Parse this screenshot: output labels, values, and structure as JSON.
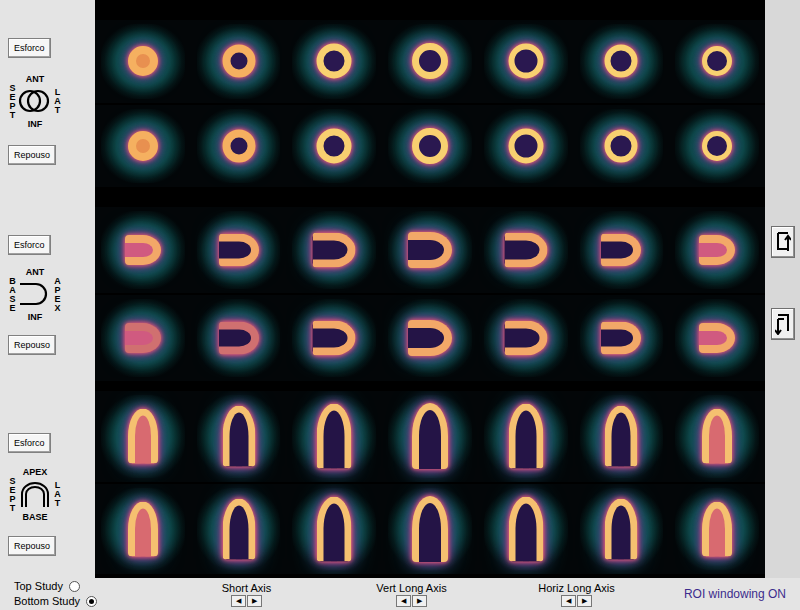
{
  "sections": [
    {
      "kind": "short",
      "stress_button": "Esforco",
      "rest_button": "Repouso",
      "orientation": {
        "top": "ANT",
        "bottom": "INF",
        "left": "SEPT",
        "right": "LAT"
      }
    },
    {
      "kind": "vertical",
      "stress_button": "Esforco",
      "rest_button": "Repouso",
      "orientation": {
        "top": "ANT",
        "bottom": "INF",
        "left": "BASE",
        "right": "APEX"
      }
    },
    {
      "kind": "horizontal",
      "stress_button": "Esforco",
      "rest_button": "Repouso",
      "orientation": {
        "top": "APEX",
        "bottom": "BASE",
        "left": "SEPT",
        "right": "LAT"
      }
    }
  ],
  "studies": [
    {
      "label": "Top Study",
      "selected": false
    },
    {
      "label": "Bottom Study",
      "selected": true
    }
  ],
  "navigators": [
    {
      "label": "Short Axis",
      "prev": "◀",
      "next": "▶"
    },
    {
      "label": "Vert Long Axis",
      "prev": "◀",
      "next": "▶"
    },
    {
      "label": "Horiz Long Axis",
      "prev": "◀",
      "next": "▶"
    }
  ],
  "status": "ROI windowing ON"
}
